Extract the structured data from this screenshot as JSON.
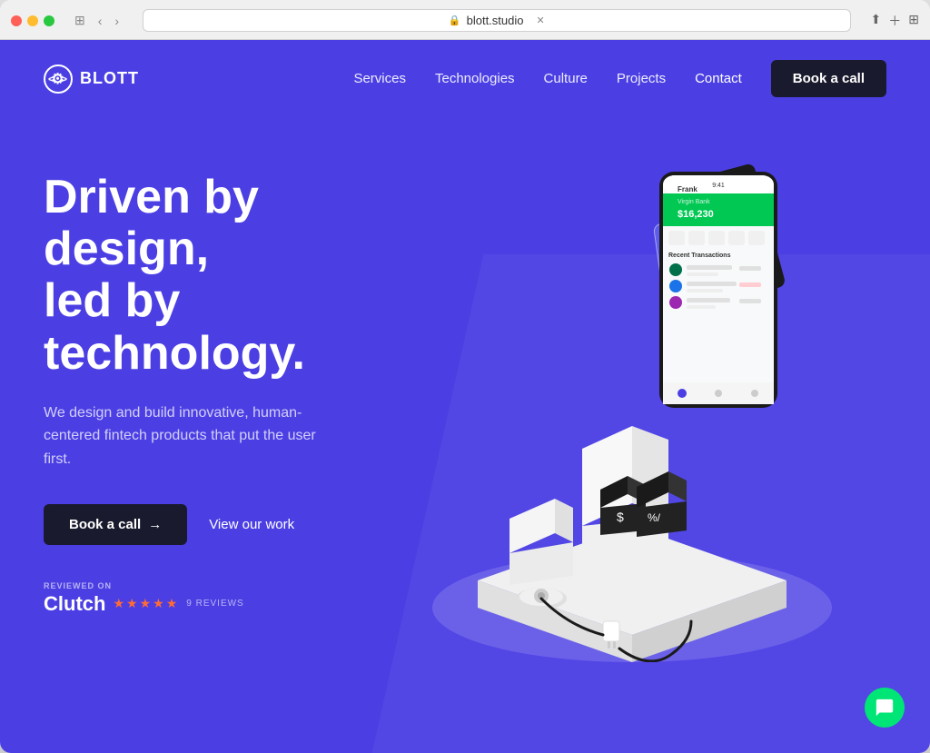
{
  "browser": {
    "url": "blott.studio",
    "tab_title": "blott.studio"
  },
  "nav": {
    "logo_text": "BLOTT",
    "links": [
      "Services",
      "Technologies",
      "Culture",
      "Projects"
    ],
    "contact": "Contact",
    "cta": "Book a call"
  },
  "hero": {
    "title_line1": "Driven by design,",
    "title_line2": "led by technology.",
    "description": "We design and build innovative, human-centered fintech products that put the user first.",
    "cta_primary": "Book a call",
    "cta_arrow": "→",
    "cta_secondary": "View our work",
    "clutch": {
      "reviewed_on": "REVIEWED ON",
      "name": "Clutch",
      "reviews": "9 REVIEWS"
    }
  },
  "chat": {
    "icon": "💬"
  }
}
